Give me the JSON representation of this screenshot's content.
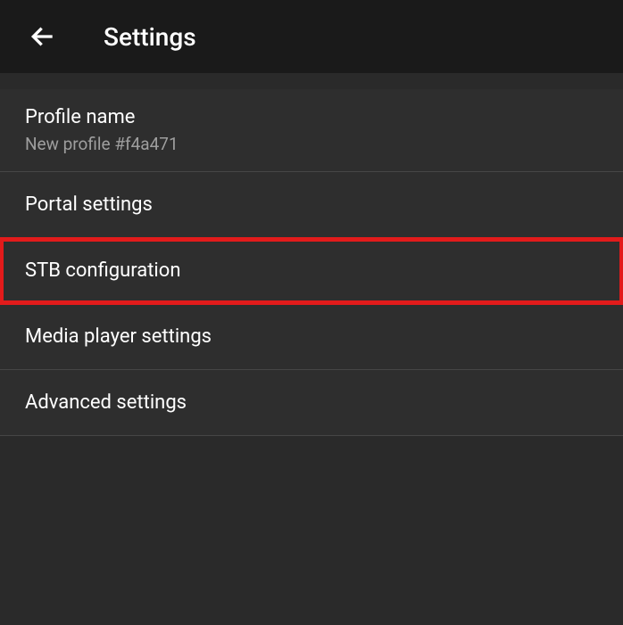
{
  "header": {
    "title": "Settings"
  },
  "items": [
    {
      "title": "Profile name",
      "subtitle": "New profile #f4a471",
      "highlighted": false
    },
    {
      "title": "Portal settings",
      "subtitle": null,
      "highlighted": false
    },
    {
      "title": "STB configuration",
      "subtitle": null,
      "highlighted": true
    },
    {
      "title": "Media player settings",
      "subtitle": null,
      "highlighted": false
    },
    {
      "title": "Advanced settings",
      "subtitle": null,
      "highlighted": false
    }
  ]
}
